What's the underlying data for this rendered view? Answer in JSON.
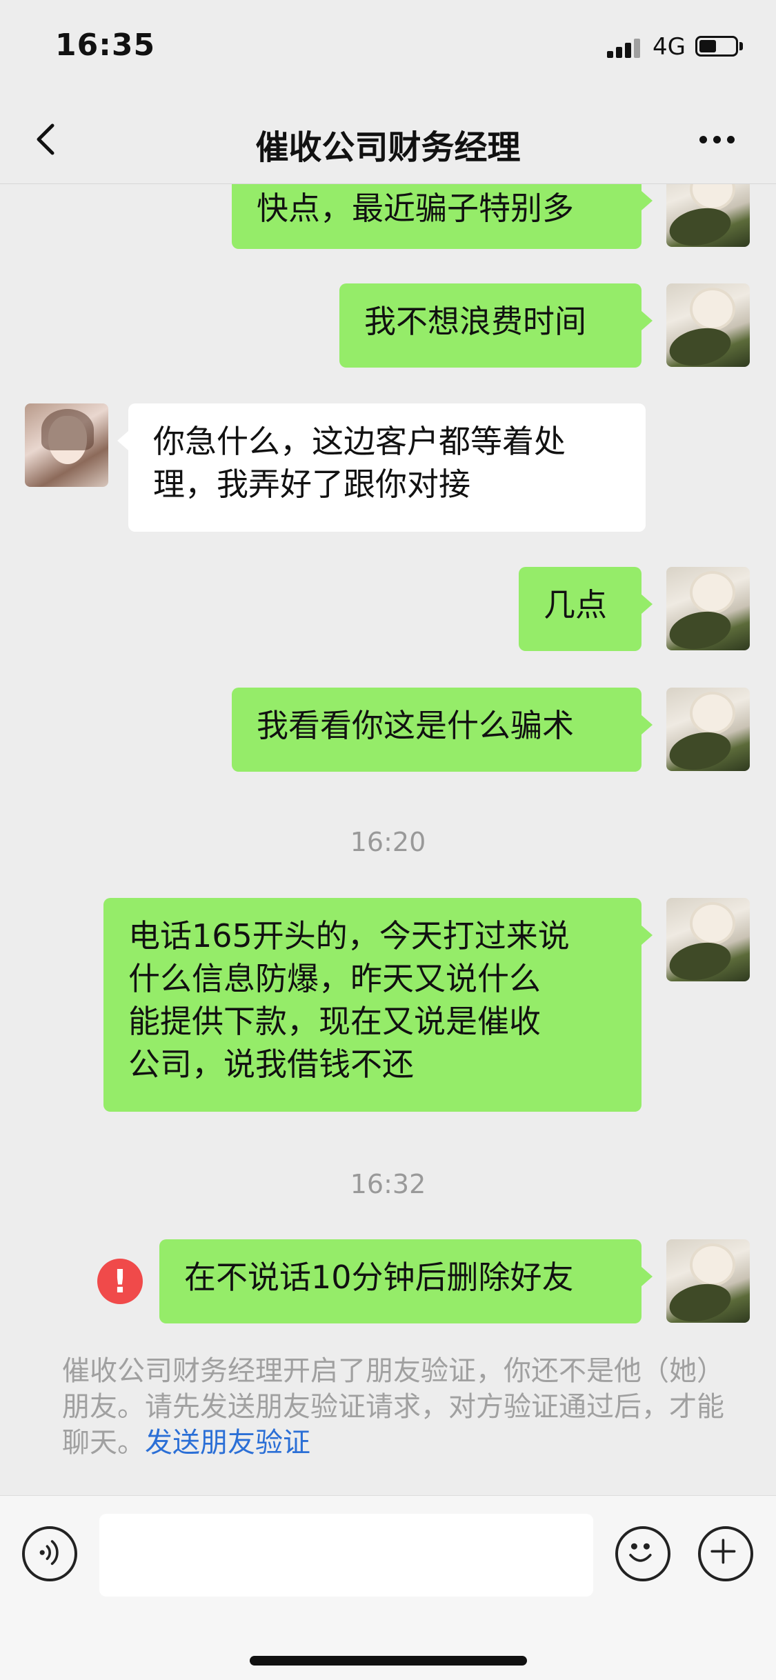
{
  "status_bar": {
    "time": "16:35",
    "network": "4G",
    "battery_level": 0.45
  },
  "nav": {
    "title": "催收公司财务经理",
    "back_icon": "chevron-left-icon",
    "more_icon": "more-dots-icon"
  },
  "messages": [
    {
      "from": "me",
      "text": "快点，最近骗子特别多"
    },
    {
      "from": "me",
      "text": "我不想浪费时间"
    },
    {
      "from": "them",
      "text": "你急什么，这边客户都等着处\n理，我弄好了跟你对接"
    },
    {
      "from": "me",
      "text": "几点"
    },
    {
      "from": "me",
      "text": "我看看你这是什么骗术"
    }
  ],
  "timestamp_1": "16:20",
  "message_long": {
    "from": "me",
    "text": "电话165开头的，今天打过来说\n什么信息防爆，昨天又说什么\n能提供下款，现在又说是催收\n公司，说我借钱不还"
  },
  "timestamp_2": "16:32",
  "message_failed": {
    "from": "me",
    "text": "在不说话10分钟后删除好友",
    "status_icon": "!"
  },
  "system_note": {
    "text": "催收公司财务经理开启了朋友验证，你还不是他（她）朋友。请先发送朋友验证请求，对方验证通过后，才能聊天。",
    "link": "发送朋友验证"
  },
  "input_bar": {
    "voice_icon": "voice-icon",
    "input_value": "",
    "emoji_icon": "emoji-icon",
    "add_icon": "plus-icon"
  },
  "colors": {
    "bubble_me": "#95ec69",
    "bubble_them": "#ffffff",
    "link": "#2b6fd6",
    "error": "#f04a4a",
    "background": "#ededed"
  }
}
